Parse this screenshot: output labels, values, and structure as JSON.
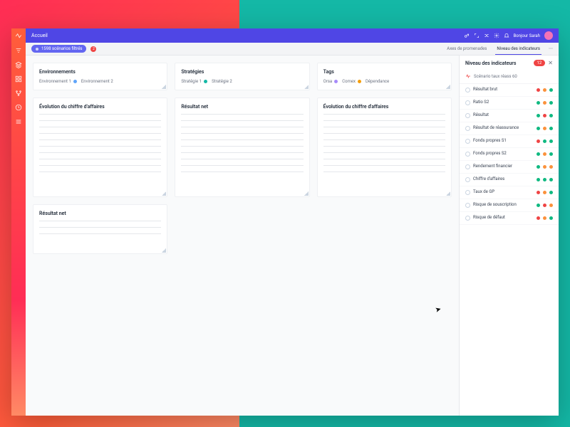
{
  "topbar": {
    "title": "Accueil",
    "greeting": "Bonjour Sarah"
  },
  "subbar": {
    "filter_pill": "1598 scénarios filtrés",
    "badge": "2"
  },
  "subtabs": {
    "left": "Axes de promenades",
    "right": "Niveau des indicateurs"
  },
  "filters": {
    "env": {
      "title": "Environnements",
      "items": [
        "Environnement 1",
        "Environnement 2"
      ]
    },
    "strat": {
      "title": "Stratégies",
      "items": [
        "Stratégie 1",
        "Stratégie 2"
      ]
    },
    "tags": {
      "title": "Tags",
      "items": [
        "Orsa",
        "Comex",
        "Dépendance"
      ]
    }
  },
  "charts": [
    "Évolution du chiffre d'affaires",
    "Résultat net",
    "Évolution du chiffre d'affaires",
    "Résultat net"
  ],
  "panel": {
    "title": "Niveau des indicateurs",
    "count": "12",
    "scenario": "Scénario taux réass 60",
    "rows": [
      {
        "label": "Résultat brut",
        "dots": [
          "r",
          "o",
          "g"
        ]
      },
      {
        "label": "Ratio S2",
        "dots": [
          "g",
          "o",
          "g"
        ]
      },
      {
        "label": "Résultat",
        "dots": [
          "g",
          "r",
          "g"
        ]
      },
      {
        "label": "Résultat de réassurance",
        "dots": [
          "g",
          "o",
          "g"
        ]
      },
      {
        "label": "Fonds propres S1",
        "dots": [
          "r",
          "g",
          "g"
        ]
      },
      {
        "label": "Fonds propres S2",
        "dots": [
          "g",
          "o",
          "g"
        ]
      },
      {
        "label": "Rendement financier",
        "dots": [
          "g",
          "o",
          "o"
        ]
      },
      {
        "label": "Chiffre d'affaires",
        "dots": [
          "g",
          "g",
          "g"
        ]
      },
      {
        "label": "Taux de GP",
        "dots": [
          "r",
          "o",
          "g"
        ]
      },
      {
        "label": "Risque de souscription",
        "dots": [
          "g",
          "r",
          "o"
        ]
      },
      {
        "label": "Risque de défaut",
        "dots": [
          "r",
          "o",
          "g"
        ]
      }
    ]
  }
}
